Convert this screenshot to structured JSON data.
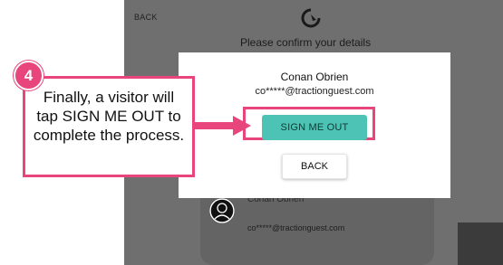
{
  "background": {
    "back_label": "BACK",
    "header": "Please confirm your details",
    "card": {
      "name": "Conan Obrien",
      "email": "co*****@tractionguest.com"
    }
  },
  "modal": {
    "name": "Conan Obrien",
    "email": "co*****@tractionguest.com",
    "sign_out_label": "SIGN ME OUT",
    "back_label": "BACK"
  },
  "annotation": {
    "step_number": "4",
    "callout_text": "Finally, a visitor will tap SIGN ME OUT to complete the process."
  },
  "colors": {
    "accent_pink": "#e8457c",
    "teal_button": "#4cc3b4",
    "dim_overlay": "#6f6f6f"
  },
  "icons": [
    "tractionguest-logo-icon",
    "avatar-icon",
    "arrow-right-icon"
  ]
}
